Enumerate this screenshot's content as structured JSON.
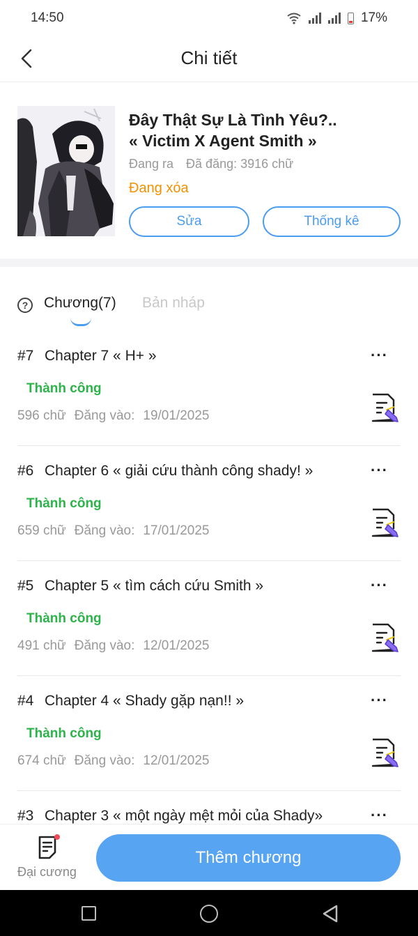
{
  "status_bar": {
    "time": "14:50",
    "battery": "17%"
  },
  "header": {
    "title": "Chi tiết"
  },
  "book": {
    "title_line1": "Đây Thật Sự Là Tình Yêu?..",
    "title_line2": "« Victim X Agent Smith »",
    "status": "Đang ra",
    "word_count": "Đã đăng: 3916 chữ",
    "state": "Đang xóa",
    "edit_label": "Sửa",
    "stats_label": "Thống kê"
  },
  "tabs": {
    "chapters": "Chương(7)",
    "drafts": "Bản nháp"
  },
  "chapters": [
    {
      "num": "#7",
      "title": "Chapter 7 « H+ »",
      "status": "Thành công",
      "words": "596 chữ",
      "date_label": "Đăng vào:",
      "date": "19/01/2025"
    },
    {
      "num": "#6",
      "title": "Chapter 6 « giải cứu thành công shady! »",
      "status": "Thành công",
      "words": "659 chữ",
      "date_label": "Đăng vào:",
      "date": "17/01/2025"
    },
    {
      "num": "#5",
      "title": "Chapter 5 « tìm cách cứu Smith »",
      "status": "Thành công",
      "words": "491 chữ",
      "date_label": "Đăng vào:",
      "date": "12/01/2025"
    },
    {
      "num": "#4",
      "title": "Chapter 4 « Shady gặp nạn!! »",
      "status": "Thành công",
      "words": "674 chữ",
      "date_label": "Đăng vào:",
      "date": "12/01/2025"
    },
    {
      "num": "#3",
      "title": "Chapter 3 « một ngày mệt mỏi của Shady»",
      "status": "",
      "words": "",
      "date_label": "",
      "date": ""
    }
  ],
  "bottom": {
    "outline_label": "Đại cương",
    "add_label": "Thêm chương"
  },
  "colors": {
    "accent": "#4a9cf0",
    "success": "#2cb34a",
    "warning": "#f39200",
    "button_fill": "#56a4f2"
  }
}
